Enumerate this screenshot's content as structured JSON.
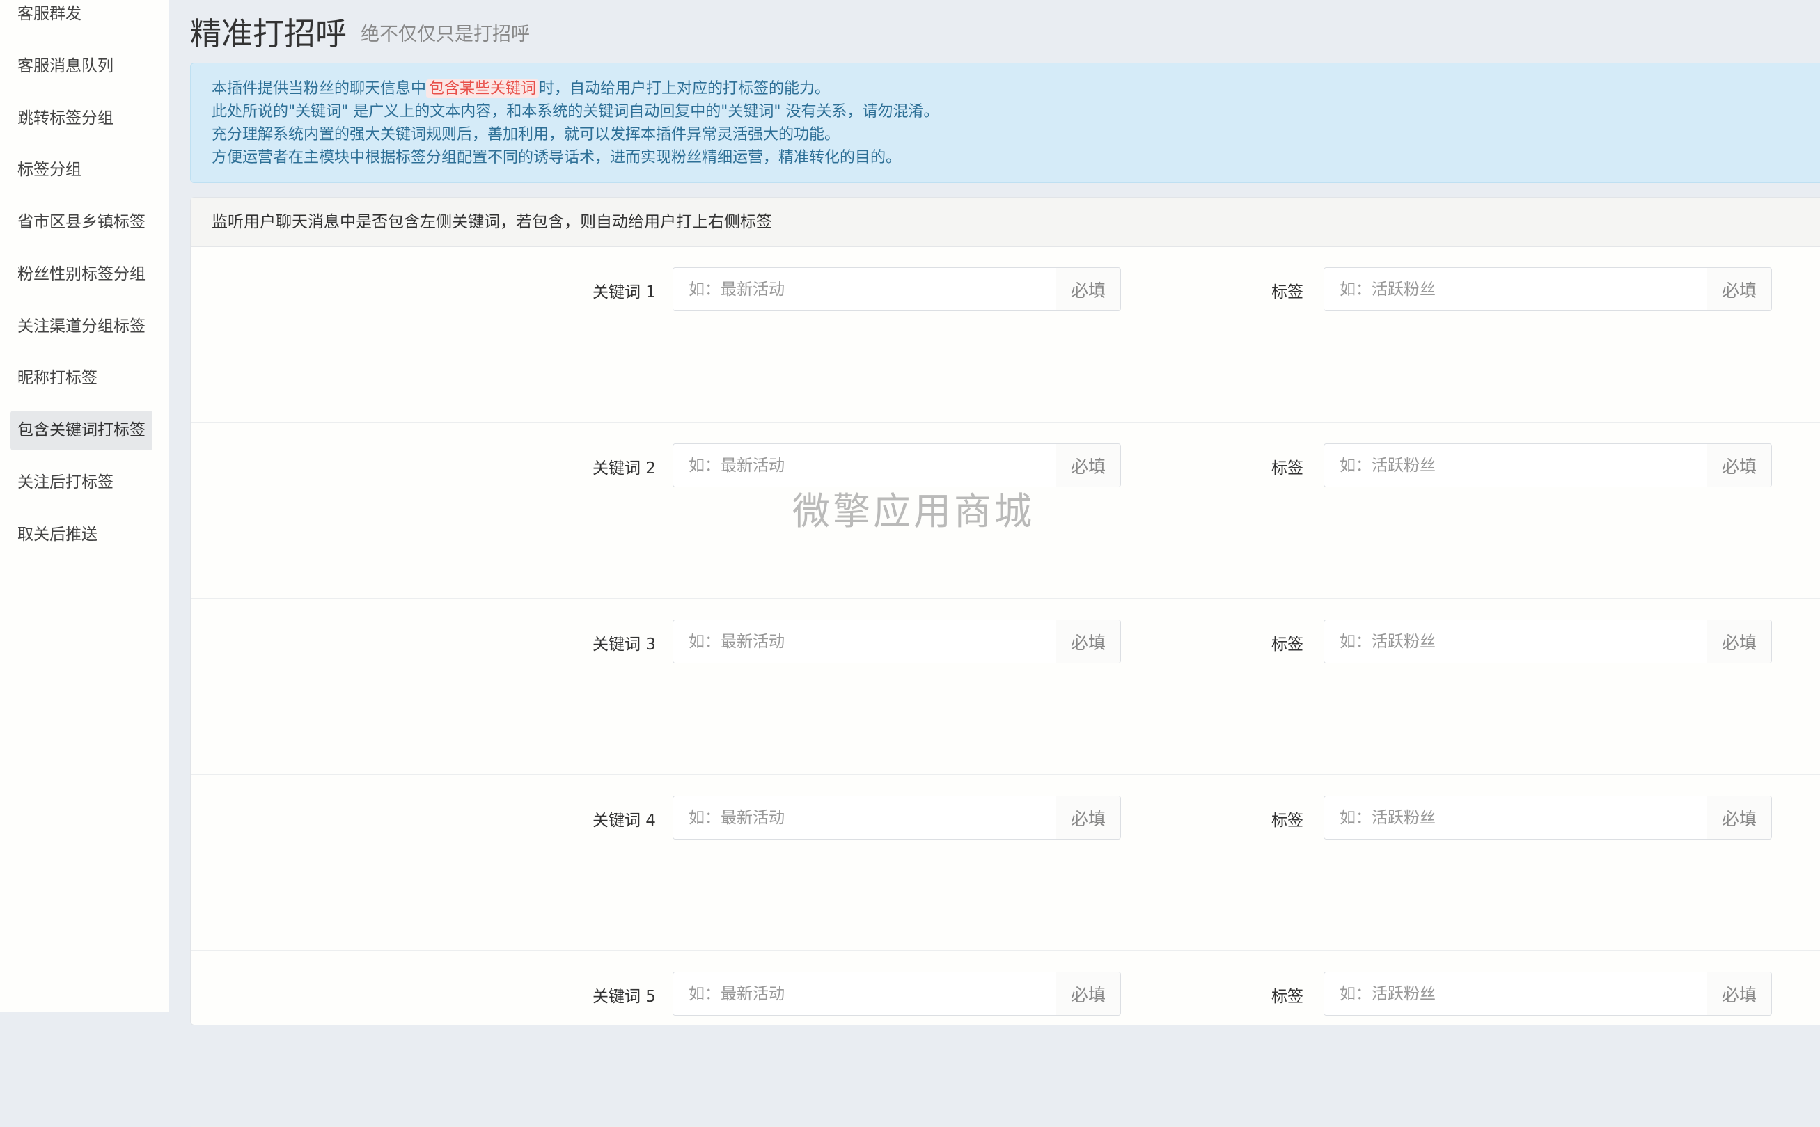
{
  "sidebar": {
    "items": [
      {
        "label": "客服群发",
        "active": false
      },
      {
        "label": "客服消息队列",
        "active": false
      },
      {
        "label": "跳转标签分组",
        "active": false
      },
      {
        "label": "标签分组",
        "active": false
      },
      {
        "label": "省市区县乡镇标签",
        "active": false
      },
      {
        "label": "粉丝性别标签分组",
        "active": false
      },
      {
        "label": "关注渠道分组标签",
        "active": false
      },
      {
        "label": "昵称打标签",
        "active": false
      },
      {
        "label": "包含关键词打标签",
        "active": true
      },
      {
        "label": "关注后打标签",
        "active": false
      },
      {
        "label": "取关后推送",
        "active": false
      }
    ]
  },
  "header": {
    "title": "精准打招呼",
    "subtitle": "绝不仅仅只是打招呼"
  },
  "notice": {
    "line1_before": "本插件提供当粉丝的聊天信息中",
    "line1_highlight": "包含某些关键词",
    "line1_after": "时，自动给用户打上对应的打标签的能力。",
    "line2": "此处所说的\"关键词\" 是广义上的文本内容，和本系统的关键词自动回复中的\"关键词\" 没有关系，请勿混淆。",
    "line3": "充分理解系统内置的强大关键词规则后，善加利用，就可以发挥本插件异常灵活强大的功能。",
    "line4": "方便运营者在主模块中根据标签分组配置不同的诱导话术，进而实现粉丝精细运营，精准转化的目的。"
  },
  "panel": {
    "heading": "监听用户聊天消息中是否包含左侧关键词，若包含，则自动给用户打上右侧标签",
    "rows": [
      {
        "keyword_label": "关键词 1",
        "keyword_placeholder": "如：最新活动",
        "keyword_value": "",
        "keyword_required": "必填",
        "tag_label": "标签",
        "tag_placeholder": "如：活跃粉丝",
        "tag_value": "",
        "tag_required": "必填"
      },
      {
        "keyword_label": "关键词 2",
        "keyword_placeholder": "如：最新活动",
        "keyword_value": "",
        "keyword_required": "必填",
        "tag_label": "标签",
        "tag_placeholder": "如：活跃粉丝",
        "tag_value": "",
        "tag_required": "必填"
      },
      {
        "keyword_label": "关键词 3",
        "keyword_placeholder": "如：最新活动",
        "keyword_value": "",
        "keyword_required": "必填",
        "tag_label": "标签",
        "tag_placeholder": "如：活跃粉丝",
        "tag_value": "",
        "tag_required": "必填"
      },
      {
        "keyword_label": "关键词 4",
        "keyword_placeholder": "如：最新活动",
        "keyword_value": "",
        "keyword_required": "必填",
        "tag_label": "标签",
        "tag_placeholder": "如：活跃粉丝",
        "tag_value": "",
        "tag_required": "必填"
      },
      {
        "keyword_label": "关键词 5",
        "keyword_placeholder": "如：最新活动",
        "keyword_value": "",
        "keyword_required": "必填",
        "tag_label": "标签",
        "tag_placeholder": "如：活跃粉丝",
        "tag_value": "",
        "tag_required": "必填"
      }
    ]
  },
  "watermark": "微擎应用商城"
}
